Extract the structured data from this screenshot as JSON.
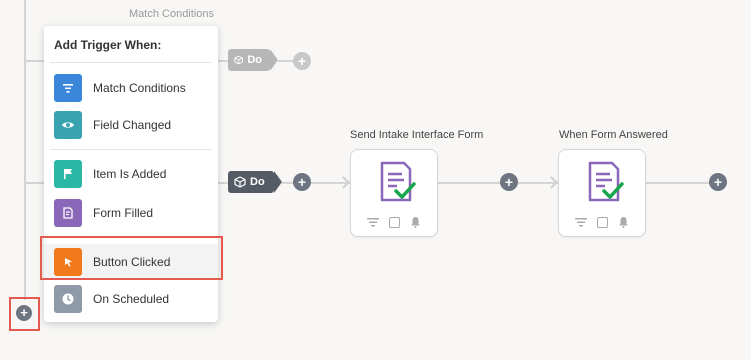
{
  "canvas": {
    "top_label": "Match Conditions"
  },
  "menu": {
    "title": "Add Trigger When:",
    "items": [
      {
        "label": "Match Conditions",
        "icon": "filter-icon",
        "color": "#3a86d8"
      },
      {
        "label": "Field Changed",
        "icon": "eye-icon",
        "color": "#3aa3b0"
      },
      {
        "label": "Item Is Added",
        "icon": "flag-icon",
        "color": "#2bb7a5"
      },
      {
        "label": "Form Filled",
        "icon": "form-icon",
        "color": "#8a67b8"
      },
      {
        "label": "Button Clicked",
        "icon": "cursor-icon",
        "color": "#f07a1c"
      },
      {
        "label": "On Scheduled",
        "icon": "clock-icon",
        "color": "#8f9aa8"
      }
    ]
  },
  "flow": {
    "do_label_top": "Do",
    "do_label_main": "Do",
    "nodes": [
      {
        "title": "Send Intake Interface Form"
      },
      {
        "title": "When Form Answered"
      }
    ]
  },
  "colors": {
    "do_top": "#b7b7b7",
    "do_main": "#555b64",
    "highlight": "#e55a4f",
    "form_purple": "#8a67b8",
    "check_green": "#17a84b"
  }
}
